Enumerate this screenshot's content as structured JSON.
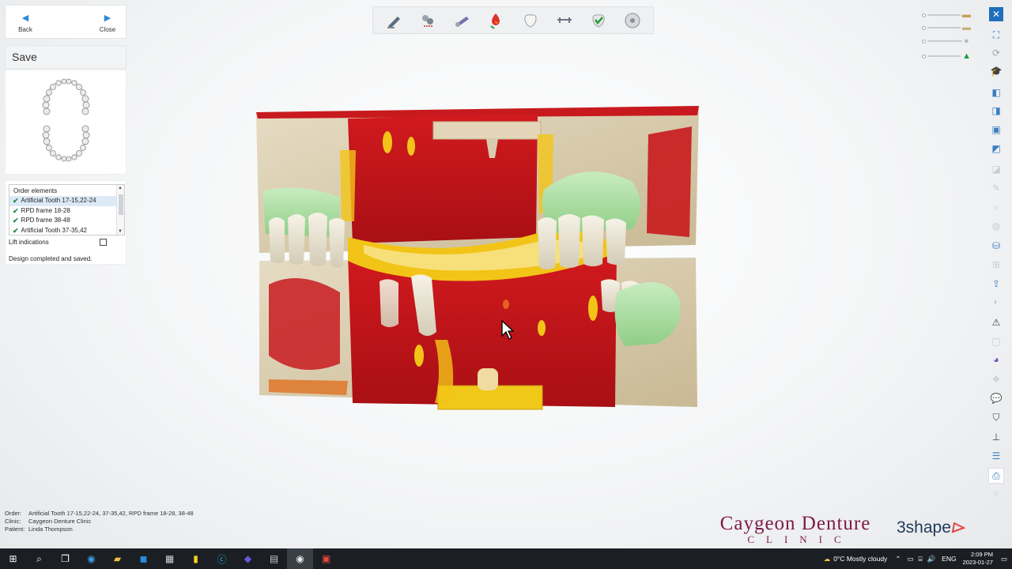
{
  "nav": {
    "back_label": "Back",
    "close_label": "Close"
  },
  "panel": {
    "title": "Save",
    "order_elements": {
      "header": "Order elements",
      "items": [
        {
          "label": "Artificial Tooth 17-15,22-24",
          "checked": true,
          "selected": true
        },
        {
          "label": "RPD frame 18-28",
          "checked": true,
          "selected": false
        },
        {
          "label": "RPD frame 38-48",
          "checked": true,
          "selected": false
        },
        {
          "label": "Artificial Tooth 37-35,42",
          "checked": true,
          "selected": false
        }
      ]
    },
    "lift_label": "Lift indications",
    "lift_checked": false,
    "status": "Design completed and saved."
  },
  "toolbar": {
    "icons": [
      "pencil-icon",
      "scissors-icon",
      "wax-knife-icon",
      "color-drop-icon",
      "tooth-icon",
      "frame-icon",
      "tooth-check-icon",
      "disc-icon"
    ]
  },
  "order_info": {
    "order_key": "Order:",
    "order_val": "Artificial Tooth 17-15,22-24, 37-35,42, RPD frame 18-28, 38-48",
    "clinic_key": "Clinic:",
    "clinic_val": "Caygeon Denture Clinic",
    "patient_key": "Patient:",
    "patient_val": "Linda Thompson"
  },
  "branding": {
    "clinic_line1": "Caygeon Denture",
    "clinic_line2": "CLINIC",
    "vendor": "3shape"
  },
  "taskbar": {
    "weather": "0°C  Mostly cloudy",
    "lang": "ENG",
    "time": "2:09 PM",
    "date": "2023-01-27"
  },
  "colors": {
    "accent": "#1f6fba",
    "clinic": "#7d1a4a",
    "model_red": "#c0141c",
    "model_yellow": "#f2c418",
    "model_beige": "#d8cbb0",
    "model_green": "#a8dca0"
  }
}
